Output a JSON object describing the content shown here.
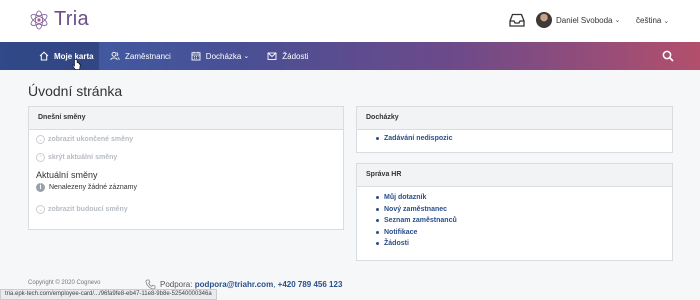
{
  "brand": {
    "name": "Tria",
    "color": "#6b4d8c"
  },
  "header": {
    "user_name": "Daniel Svoboda",
    "language": "čeština"
  },
  "nav": {
    "items": [
      {
        "label": "Moje karta",
        "icon": "home-icon",
        "active": true
      },
      {
        "label": "Zaměstnanci",
        "icon": "users-icon"
      },
      {
        "label": "Docházka",
        "icon": "calendar-icon",
        "dropdown": true
      },
      {
        "label": "Žádosti",
        "icon": "envelope-icon"
      }
    ]
  },
  "page": {
    "title": "Úvodní stránka"
  },
  "shifts_card": {
    "title": "Dnešní směny",
    "show_finished": "zobrazit ukončené směny",
    "hide_current": "skrýt aktuální směny",
    "current_heading": "Aktuální směny",
    "no_records": "Nenalezeny žádné záznamy",
    "show_future": "zobrazit budoucí směny"
  },
  "attendance_card": {
    "title": "Docházky",
    "links": [
      "Zadávání nedispozic"
    ]
  },
  "hr_card": {
    "title": "Správa HR",
    "links": [
      "Můj dotazník",
      "Nový zaměstnanec",
      "Seznam zaměstnanců",
      "Notifikace",
      "Žádosti"
    ]
  },
  "footer": {
    "copyright": "Copyright © 2020 Cognevo",
    "support_label": "Podpora:",
    "support_email": "podpora@triahr.com",
    "separator": ",",
    "support_phone": "+420 789 456 123"
  },
  "statusbar": {
    "url": "tria.epk-tech.com/employee-card/.../96fa9fe8-eb47-11e8-9b8e-52540000346a"
  }
}
